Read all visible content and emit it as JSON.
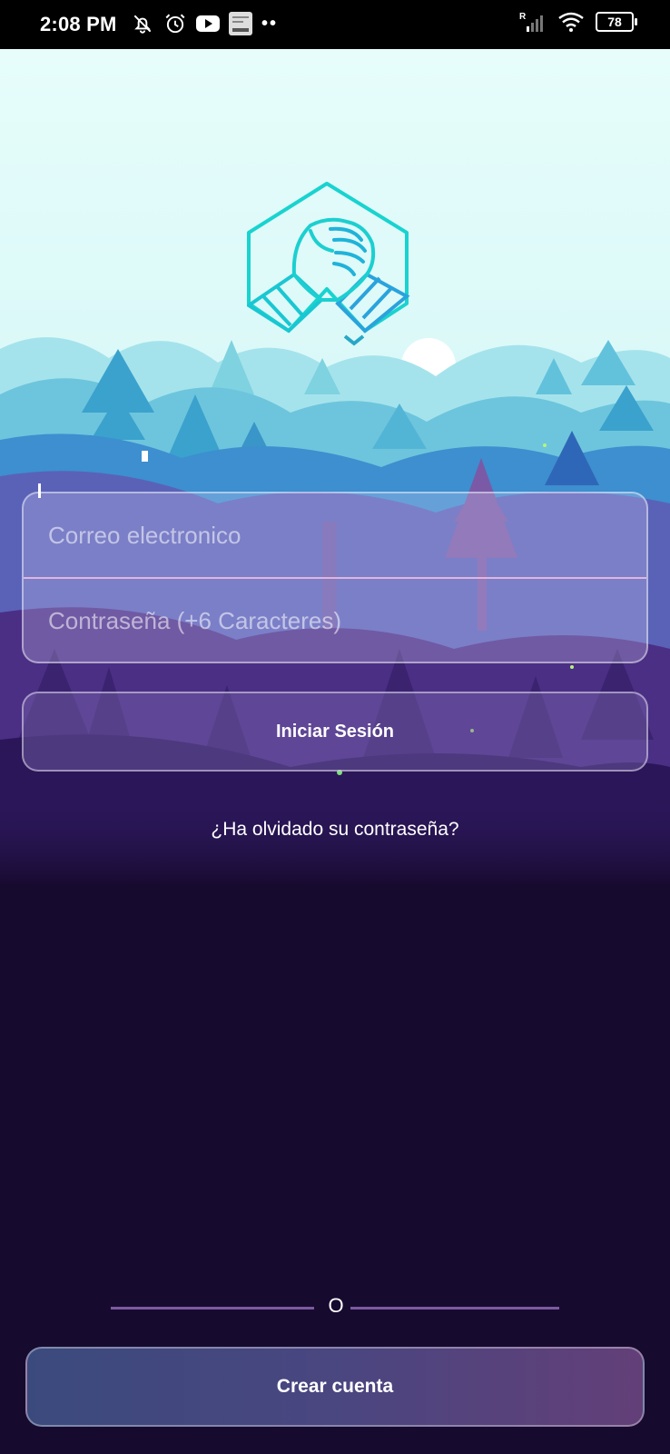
{
  "status_bar": {
    "time": "2:08 PM",
    "battery": "78",
    "signal_label": "R"
  },
  "login_form": {
    "email_placeholder": "Correo electronico",
    "password_placeholder": "Contraseña (+6 Caracteres)",
    "login_button": "Iniciar Sesión",
    "forgot_password": "¿Ha olvidado su contraseña?"
  },
  "separator_text": "O",
  "create_account_button": "Crear cuenta",
  "colors": {
    "background": "#170a2f",
    "logo_stroke": "#19d3cf",
    "separator": "#7b5aa0"
  },
  "icons": [
    "bell-off-icon",
    "alarm-icon",
    "youtube-icon",
    "notification-thumbnail-icon",
    "signal-icon",
    "wifi-icon",
    "battery-icon",
    "handshake-logo-icon"
  ]
}
